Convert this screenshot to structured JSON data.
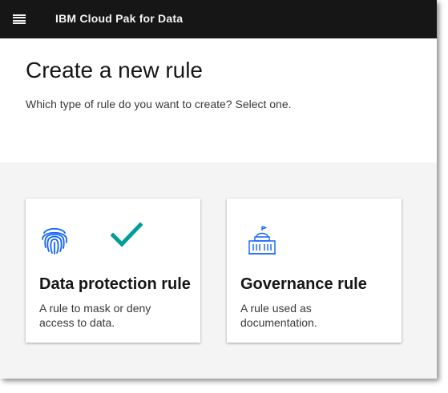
{
  "header": {
    "menu_icon": "hamburger-menu-icon",
    "product_name": "IBM Cloud Pak for Data"
  },
  "page": {
    "title": "Create a new rule",
    "subtitle": "Which type of rule do you want to create? Select one."
  },
  "tiles": [
    {
      "title": "Data protection rule",
      "description": "A rule to mask or deny access to data.",
      "icon": "fingerprint-icon",
      "selected": true,
      "selected_icon": "checkmark-icon"
    },
    {
      "title": "Governance rule",
      "description": "A rule used as documentation.",
      "icon": "government-building-icon",
      "selected": false
    }
  ],
  "colors": {
    "header_bg": "#161616",
    "icon_blue": "#0f62fe",
    "check_teal": "#009d9a",
    "page_bg": "#f4f4f4"
  }
}
